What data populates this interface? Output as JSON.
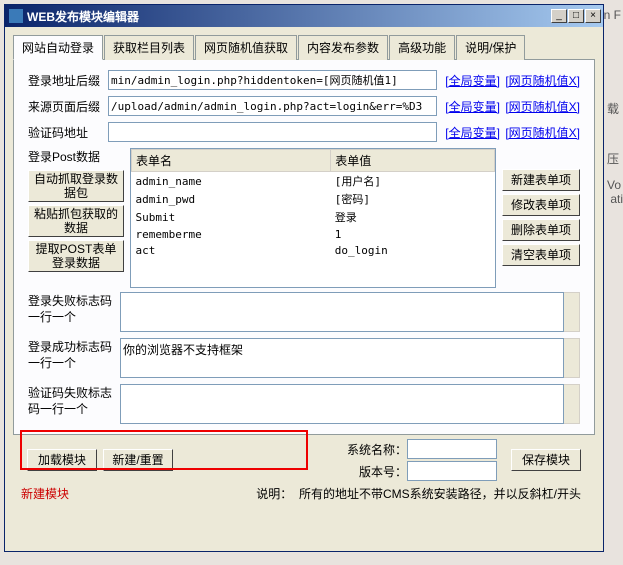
{
  "bg": {
    "t1": "n F",
    "t2": "载",
    "t3": "压",
    "t4": "Vo",
    "t5": "ati"
  },
  "title": "WEB发布模块编辑器",
  "winbtns": {
    "min": "_",
    "max": "□",
    "close": "×"
  },
  "tabs": [
    "网站自动登录",
    "获取栏目列表",
    "网页随机值获取",
    "内容发布参数",
    "高级功能",
    "说明/保护"
  ],
  "labels": {
    "loginAddr": "登录地址后缀",
    "refererAddr": "来源页面后缀",
    "captchaAddr": "验证码地址",
    "postData": "登录Post数据"
  },
  "inputs": {
    "loginAddr": "min/admin_login.php?hiddentoken=[网页随机值1]",
    "refererAddr": "/upload/admin/admin_login.php?act=login&err=%D3",
    "captchaAddr": ""
  },
  "linkGlobal": "[全局变量]",
  "linkRandom": "[网页随机值X]",
  "leftBtns": [
    "自动抓取登录数据包",
    "粘贴抓包获取的数据",
    "提取POST表单登录数据"
  ],
  "tableHeaders": [
    "表单名",
    "表单值"
  ],
  "tableRows": [
    {
      "name": "admin_name",
      "val": "[用户名]"
    },
    {
      "name": "admin_pwd",
      "val": "[密码]"
    },
    {
      "name": "Submit",
      "val": "登录"
    },
    {
      "name": "rememberme",
      "val": "1"
    },
    {
      "name": "act",
      "val": "do_login"
    }
  ],
  "rightBtns": [
    "新建表单项",
    "修改表单项",
    "删除表单项",
    "清空表单项"
  ],
  "ta": {
    "failLabel": "登录失败标志码一行一个",
    "failVal": "",
    "succLabel": "登录成功标志码一行一个",
    "succVal": "你的浏览器不支持框架",
    "capFailLabel": "验证码失败标志码一行一个",
    "capFailVal": ""
  },
  "bottom": {
    "load": "加载模块",
    "reset": "新建/重置",
    "sysName": "系统名称：",
    "version": "版本号：",
    "save": "保存模块"
  },
  "status": {
    "left": "新建模块",
    "rightLabel": "说明：",
    "rightText": "所有的地址不带CMS系统安装路径，并以反斜杠/开头"
  }
}
